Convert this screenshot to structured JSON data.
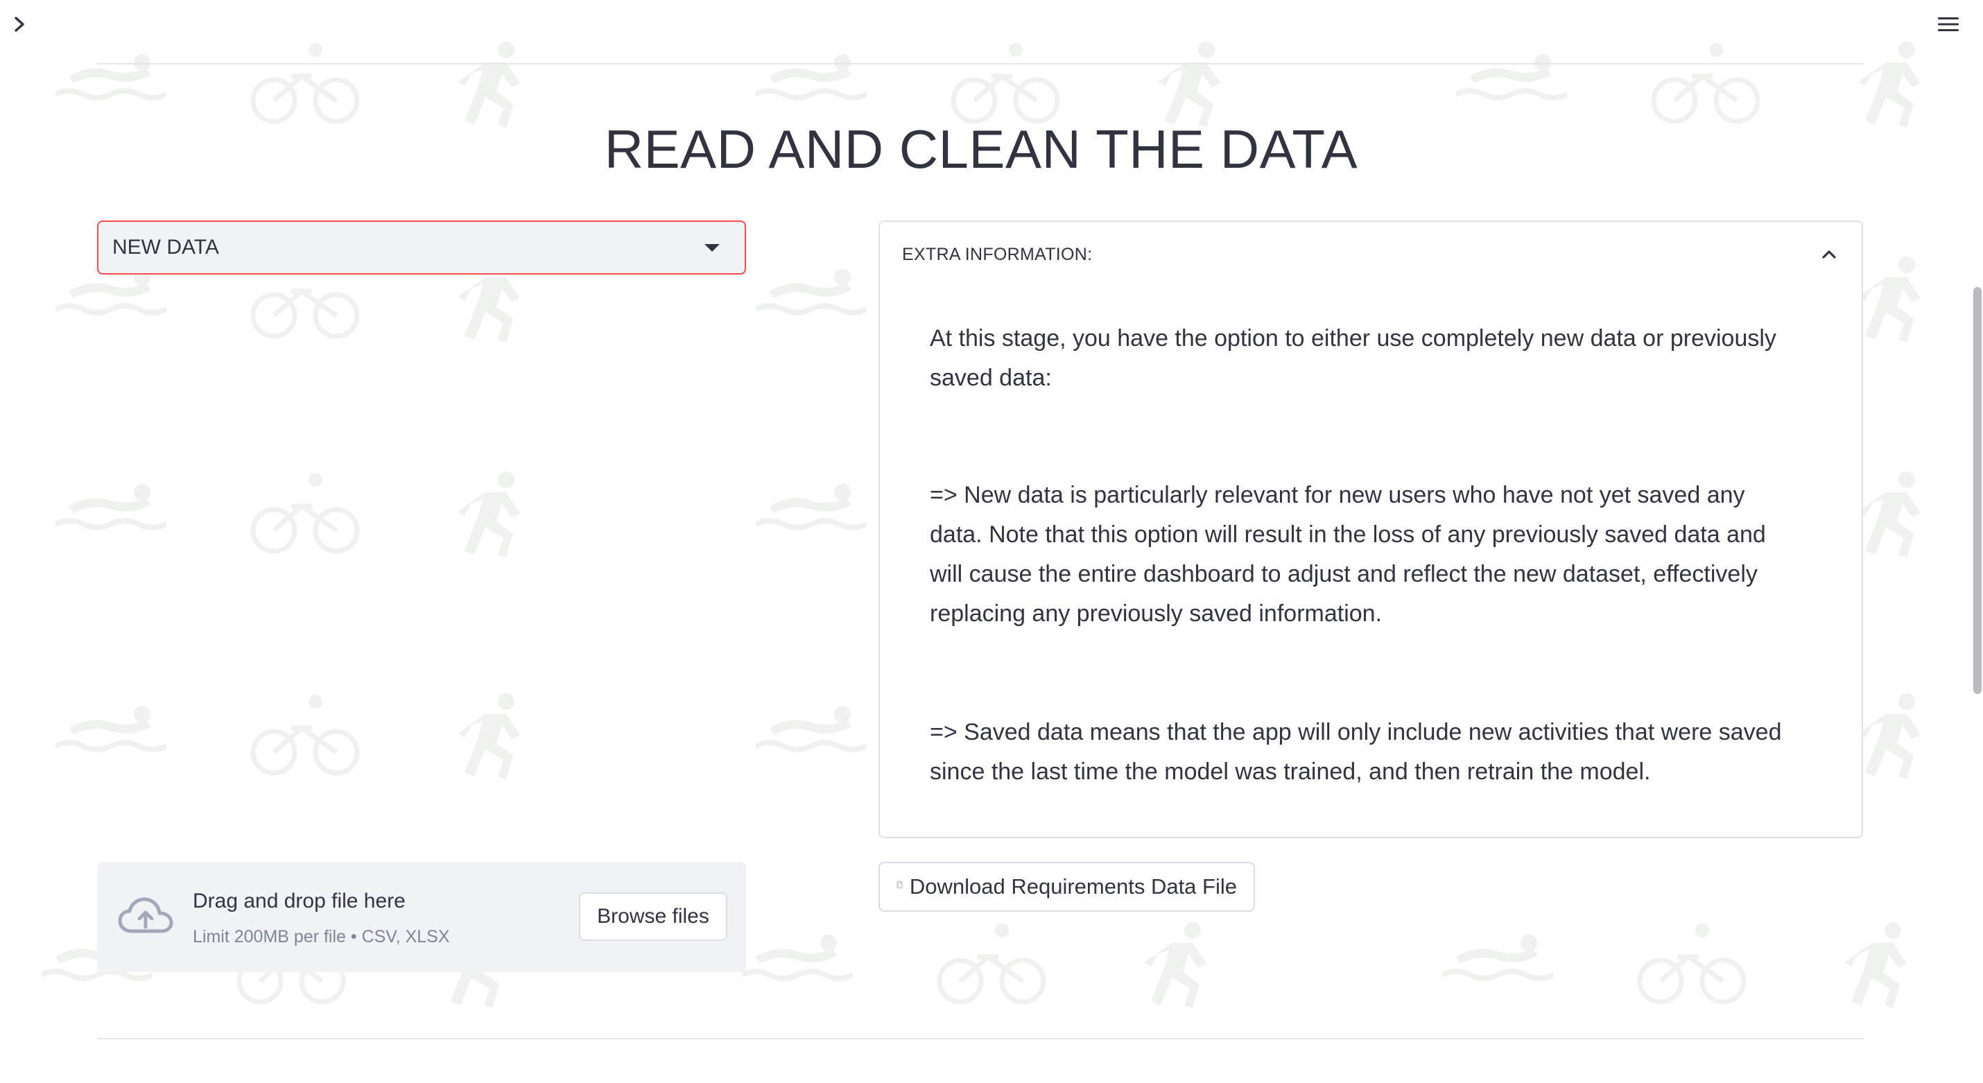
{
  "header": {
    "sidebar_toggle_icon": "chevron-right-icon",
    "menu_icon": "hamburger-menu-icon"
  },
  "page": {
    "title": "READ AND CLEAN THE DATA",
    "background_pattern": "triathlon-swim-bike-run-icons"
  },
  "data_source_select": {
    "value": "NEW DATA",
    "accent_color": "#ff4b4b"
  },
  "extra_info": {
    "title": "EXTRA INFORMATION:",
    "expanded": true,
    "paragraphs": [
      "At this stage, you have the option to either use completely new data or previously saved data:",
      "=> New data is particularly relevant for new users who have not yet saved any data. Note that this option will result in the loss of any previously saved data and will cause the entire dashboard to adjust and reflect the new dataset, effectively replacing any previously saved information.",
      "=> Saved data means that the app will only include new activities that were saved since the last time the model was trained, and then retrain the model."
    ]
  },
  "uploader": {
    "title": "Drag and drop file here",
    "limit": "Limit 200MB per file • CSV, XLSX",
    "browse_label": "Browse files",
    "icon": "cloud-upload-icon"
  },
  "download": {
    "label": "Download Requirements Data File",
    "icon": "document-icon"
  }
}
